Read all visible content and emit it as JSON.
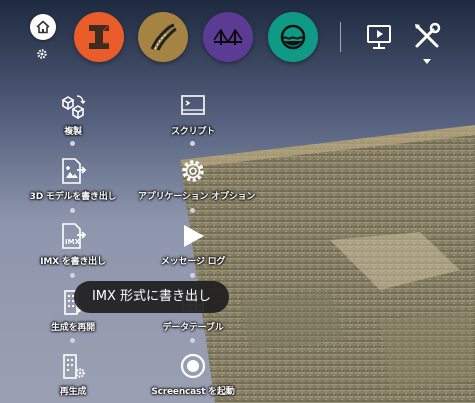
{
  "toolbar": {
    "buttons": [
      {
        "name": "imx-tool",
        "color": "#ea5d2a",
        "icon": "i-beam-icon"
      },
      {
        "name": "road-tool",
        "color": "#a58443",
        "icon": "road-icon"
      },
      {
        "name": "bridge-tool",
        "color": "#5b3b93",
        "icon": "bridge-icon"
      },
      {
        "name": "water-tool",
        "color": "#0f9a86",
        "icon": "water-icon"
      }
    ],
    "home_icon": "home-icon",
    "settings_icon": "gear-icon",
    "presentation_icon": "presentation-icon",
    "tools_icon": "tools-icon"
  },
  "menu": {
    "left": [
      {
        "label": "複製",
        "icon": "copy-icon"
      },
      {
        "label": "3D モデルを書き出し",
        "icon": "export-image-icon"
      },
      {
        "label": "IMX を書き出し",
        "icon": "export-imx-icon"
      },
      {
        "label": "生成を再開",
        "icon": "building-icon"
      },
      {
        "label": "再生成",
        "icon": "building-gear-icon"
      }
    ],
    "right": [
      {
        "label": "スクリプト",
        "icon": "script-icon"
      },
      {
        "label": "アプリケーション オプション",
        "icon": "settings-icon"
      },
      {
        "label": "メッセージ ログ",
        "icon": "play-icon"
      },
      {
        "label": "データテーブル",
        "icon": "table-icon"
      },
      {
        "label": "Screencast を起動",
        "icon": "record-icon"
      }
    ]
  },
  "tooltip": {
    "text": "IMX 形式に書き出し"
  }
}
